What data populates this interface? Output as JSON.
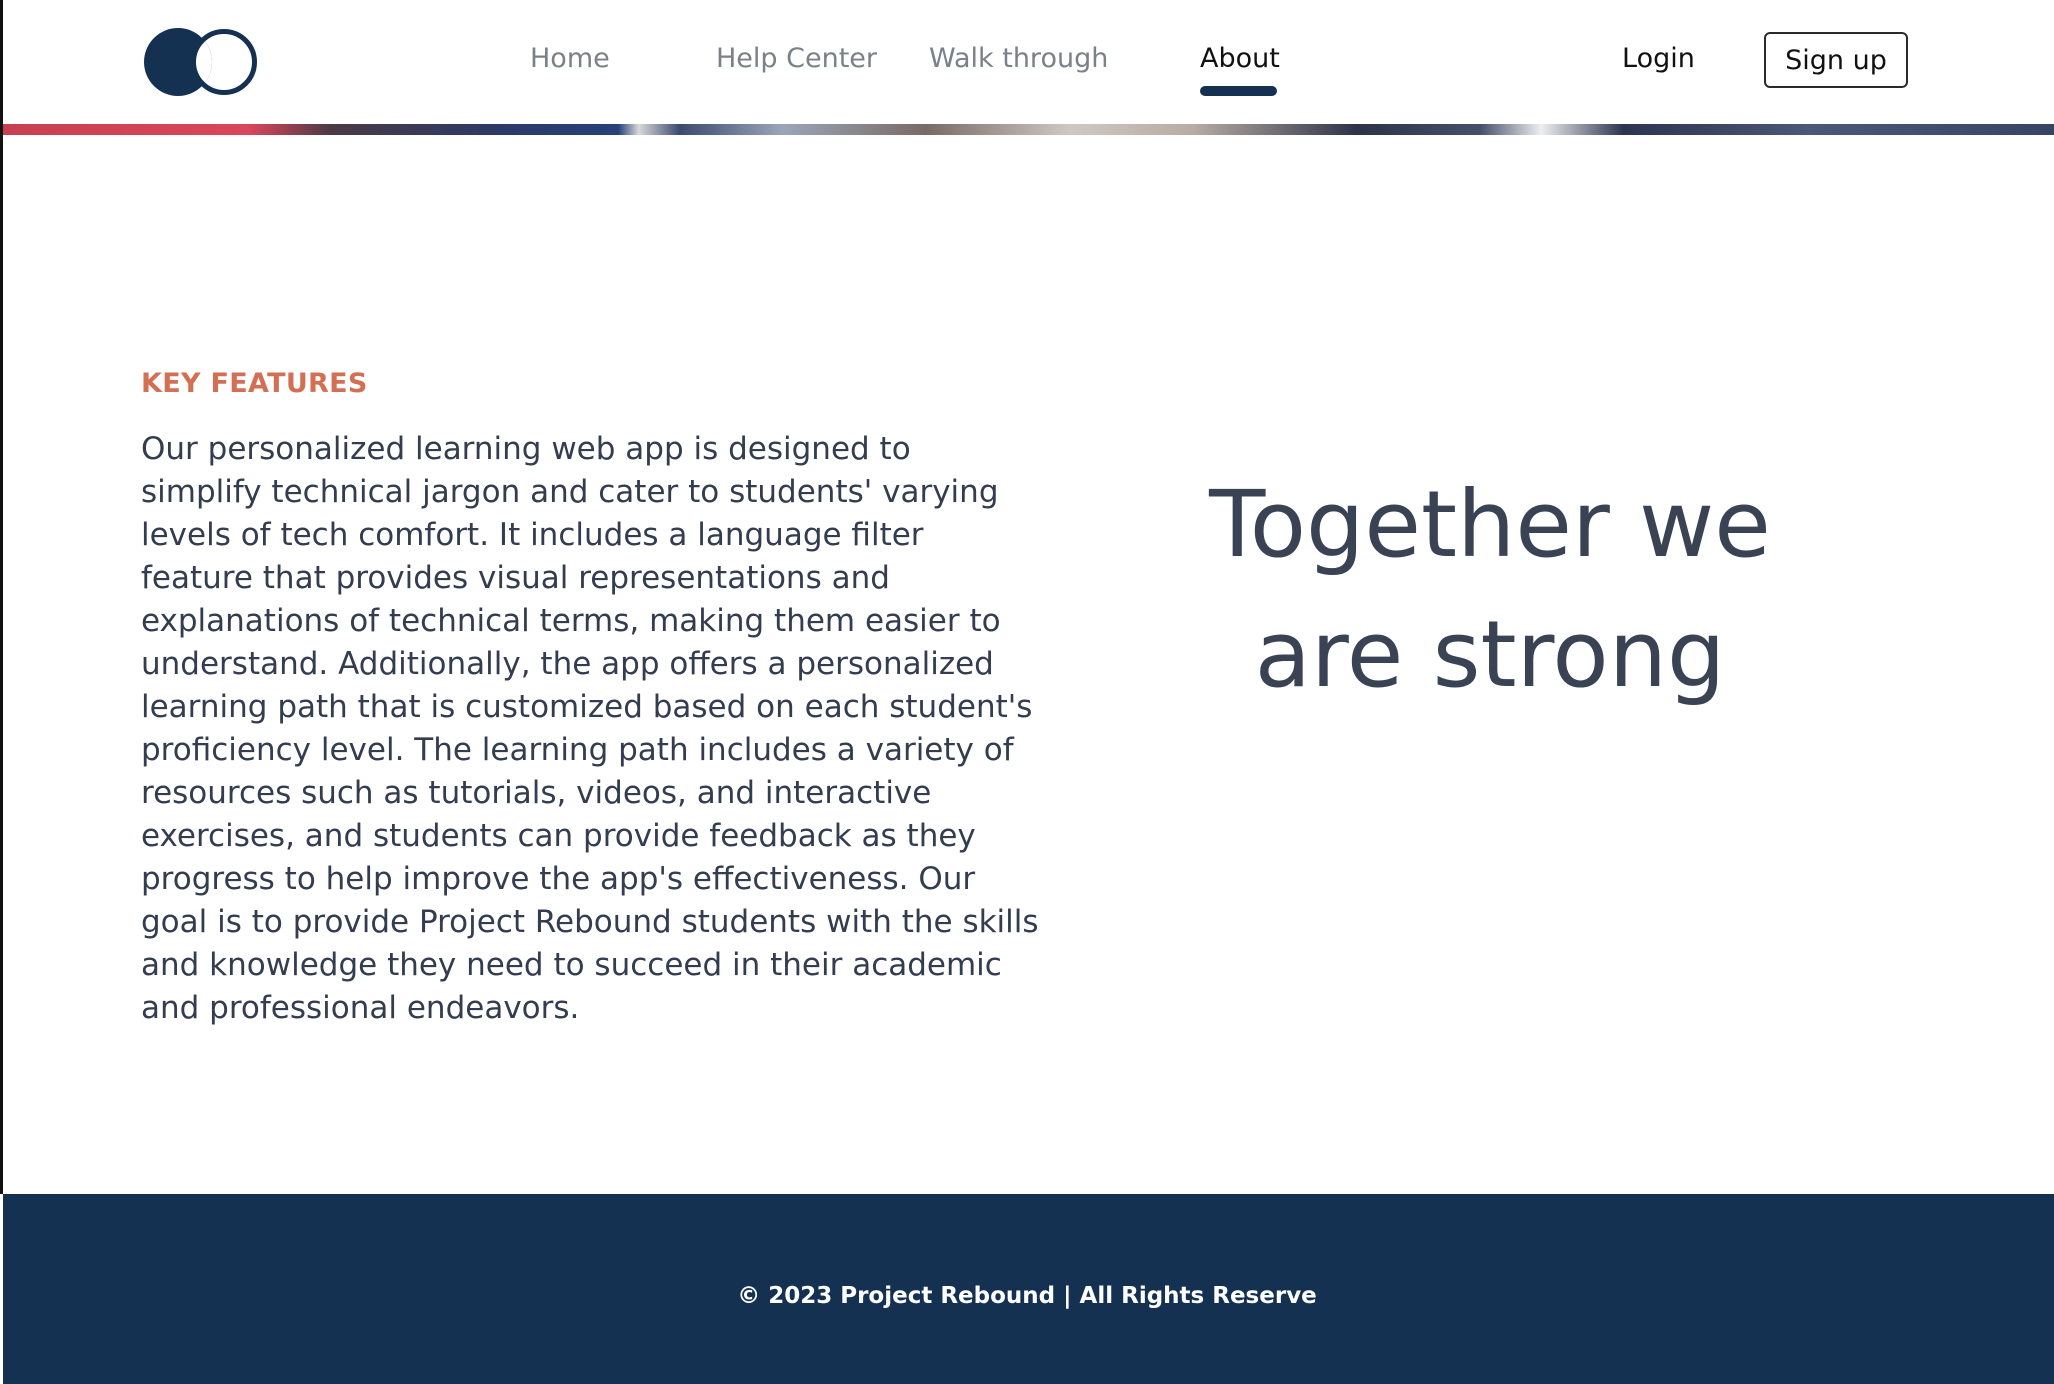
{
  "nav": {
    "links": [
      {
        "label": "Home",
        "active": false
      },
      {
        "label": "Help Center",
        "active": false
      },
      {
        "label": "Walk through",
        "active": false
      },
      {
        "label": "About",
        "active": true
      }
    ],
    "login_label": "Login",
    "signup_label": "Sign up"
  },
  "logo": {
    "icon": "overlapping-circles-logo-icon"
  },
  "main": {
    "section_label": "KEY FEATURES",
    "description": "Our personalized learning web app is designed to simplify technical jargon and cater to students' varying levels of tech comfort. It includes a language filter feature that provides visual representations and explanations of technical terms, making them easier to understand. Additionally, the app offers a personalized learning path that is customized based on each student's proficiency level. The learning path includes a variety of resources such as tutorials, videos, and interactive exercises, and students can provide feedback as they progress to help improve the app's effectiveness. Our goal is to provide Project Rebound students with the skills and knowledge they need to succeed in their academic and professional endeavors.",
    "tagline_line1": "Together we",
    "tagline_line2": "are strong"
  },
  "footer": {
    "copyright": "© 2023 Project Rebound | All Rights Reserve"
  },
  "colors": {
    "brand_navy": "#153152",
    "accent_orange": "#d36f53",
    "body_text": "#333d4f",
    "nav_inactive": "#7b8189"
  }
}
